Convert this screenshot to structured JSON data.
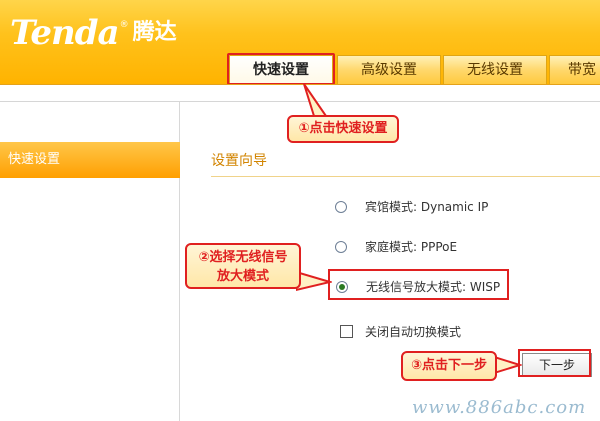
{
  "brand": {
    "logo_text": "Tenda",
    "logo_reg": "®",
    "logo_cn": "腾达"
  },
  "tabs": [
    {
      "label": "快速设置",
      "active": true
    },
    {
      "label": "高级设置",
      "active": false
    },
    {
      "label": "无线设置",
      "active": false
    },
    {
      "label": "带宽",
      "active": false
    }
  ],
  "sidebar": {
    "items": [
      {
        "label": "快速设置",
        "selected": true
      }
    ]
  },
  "main": {
    "section_title": "设置向导",
    "options": [
      {
        "label": "宾馆模式:  Dynamic IP",
        "checked": false
      },
      {
        "label": "家庭模式:  PPPoE",
        "checked": false
      },
      {
        "label": "无线信号放大模式:   WISP",
        "checked": true
      }
    ],
    "auto_switch_label": "关闭自动切换模式",
    "next_button": "下一步"
  },
  "callouts": {
    "step1": "①点击快速设置",
    "step2_line1": "②选择无线信号",
    "step2_line2": "放大模式",
    "step3": "③点击下一步"
  },
  "watermark": "www.886abc.com",
  "colors": {
    "accent": "#ffb300",
    "highlight": "#e02020",
    "section_title": "#d28400"
  }
}
